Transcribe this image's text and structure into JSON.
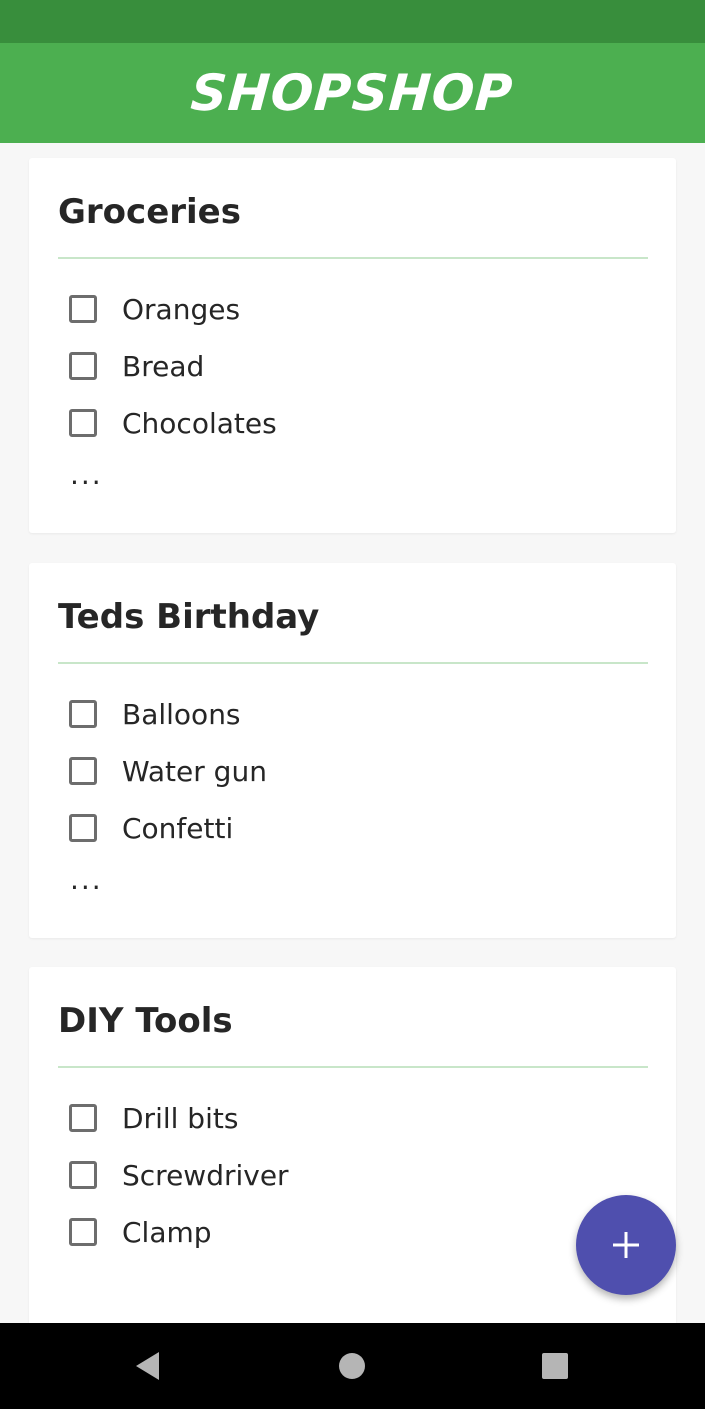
{
  "app": {
    "title": "SHOPSHOP",
    "header_color": "#4caf50",
    "status_bar_color": "#388e3c"
  },
  "lists": [
    {
      "title": "Groceries",
      "items": [
        {
          "label": "Oranges",
          "checked": false
        },
        {
          "label": "Bread",
          "checked": false
        },
        {
          "label": "Chocolates",
          "checked": false
        }
      ],
      "more": "..."
    },
    {
      "title": "Teds Birthday",
      "items": [
        {
          "label": "Balloons",
          "checked": false
        },
        {
          "label": "Water gun",
          "checked": false
        },
        {
          "label": "Confetti",
          "checked": false
        }
      ],
      "more": "..."
    },
    {
      "title": "DIY Tools",
      "items": [
        {
          "label": "Drill bits",
          "checked": false
        },
        {
          "label": "Screwdriver",
          "checked": false
        },
        {
          "label": "Clamp",
          "checked": false
        }
      ]
    }
  ],
  "fab": {
    "icon": "plus-icon",
    "color": "#4f4fae"
  },
  "nav": {
    "buttons": [
      "back-icon",
      "home-icon",
      "recents-icon"
    ]
  }
}
